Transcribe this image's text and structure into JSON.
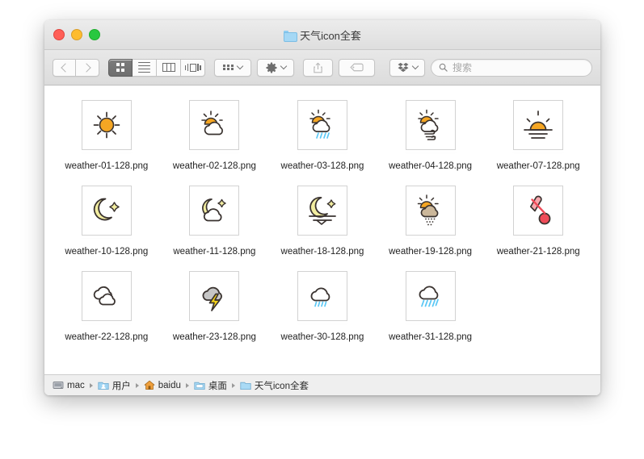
{
  "window": {
    "title": "天气icon全套",
    "title_icon": "folder-icon",
    "traffic_lights": [
      {
        "name": "close",
        "color": "#ff5f57"
      },
      {
        "name": "minimize",
        "color": "#febc2e"
      },
      {
        "name": "maximize",
        "color": "#28c840"
      }
    ]
  },
  "toolbar": {
    "back_icon": "chevron-left-icon",
    "forward_icon": "chevron-right-icon",
    "views": [
      {
        "name": "icon-view",
        "icon": "grid-icon",
        "active": true
      },
      {
        "name": "list-view",
        "icon": "list-icon",
        "active": false
      },
      {
        "name": "column-view",
        "icon": "columns-icon",
        "active": false
      },
      {
        "name": "gallery-view",
        "icon": "gallery-icon",
        "active": false
      }
    ],
    "arrange_icon": "arrange-grid-icon",
    "action_icon": "gear-icon",
    "share_icon": "share-icon",
    "tag_icon": "tag-icon",
    "dropbox_icon": "dropbox-icon",
    "search": {
      "icon": "search-icon",
      "placeholder": "搜索",
      "value": ""
    }
  },
  "files": [
    {
      "label": "weather-01-128.png",
      "icon": "sun"
    },
    {
      "label": "weather-02-128.png",
      "icon": "sun-cloud"
    },
    {
      "label": "weather-03-128.png",
      "icon": "sun-cloud-rain"
    },
    {
      "label": "weather-04-128.png",
      "icon": "sun-cloud-wind"
    },
    {
      "label": "weather-07-128.png",
      "icon": "sunrise"
    },
    {
      "label": "weather-10-128.png",
      "icon": "moon-star"
    },
    {
      "label": "weather-11-128.png",
      "icon": "moon-cloud"
    },
    {
      "label": "weather-18-128.png",
      "icon": "moon-horizon"
    },
    {
      "label": "weather-19-128.png",
      "icon": "sun-cloud-snow"
    },
    {
      "label": "weather-21-128.png",
      "icon": "thermometer"
    },
    {
      "label": "weather-22-128.png",
      "icon": "clouds"
    },
    {
      "label": "weather-23-128.png",
      "icon": "cloud-lightning"
    },
    {
      "label": "weather-30-128.png",
      "icon": "cloud-rain-light"
    },
    {
      "label": "weather-31-128.png",
      "icon": "cloud-rain-heavy"
    }
  ],
  "pathbar": [
    {
      "label": "mac",
      "icon": "harddisk-icon"
    },
    {
      "label": "用户",
      "icon": "users-folder-icon"
    },
    {
      "label": "baidu",
      "icon": "home-icon"
    },
    {
      "label": "桌面",
      "icon": "desktop-folder-icon"
    },
    {
      "label": "天气icon全套",
      "icon": "folder-icon"
    }
  ],
  "colors": {
    "sun": "#f5a623",
    "moon": "#f2eda0",
    "rain": "#5bc8f5",
    "thermometer": "#ef4b58",
    "lightning": "#f5d31a",
    "cloud_gray": "#c6c6c6",
    "cloud_tan": "#cbb79a",
    "outline": "#3a3330"
  }
}
